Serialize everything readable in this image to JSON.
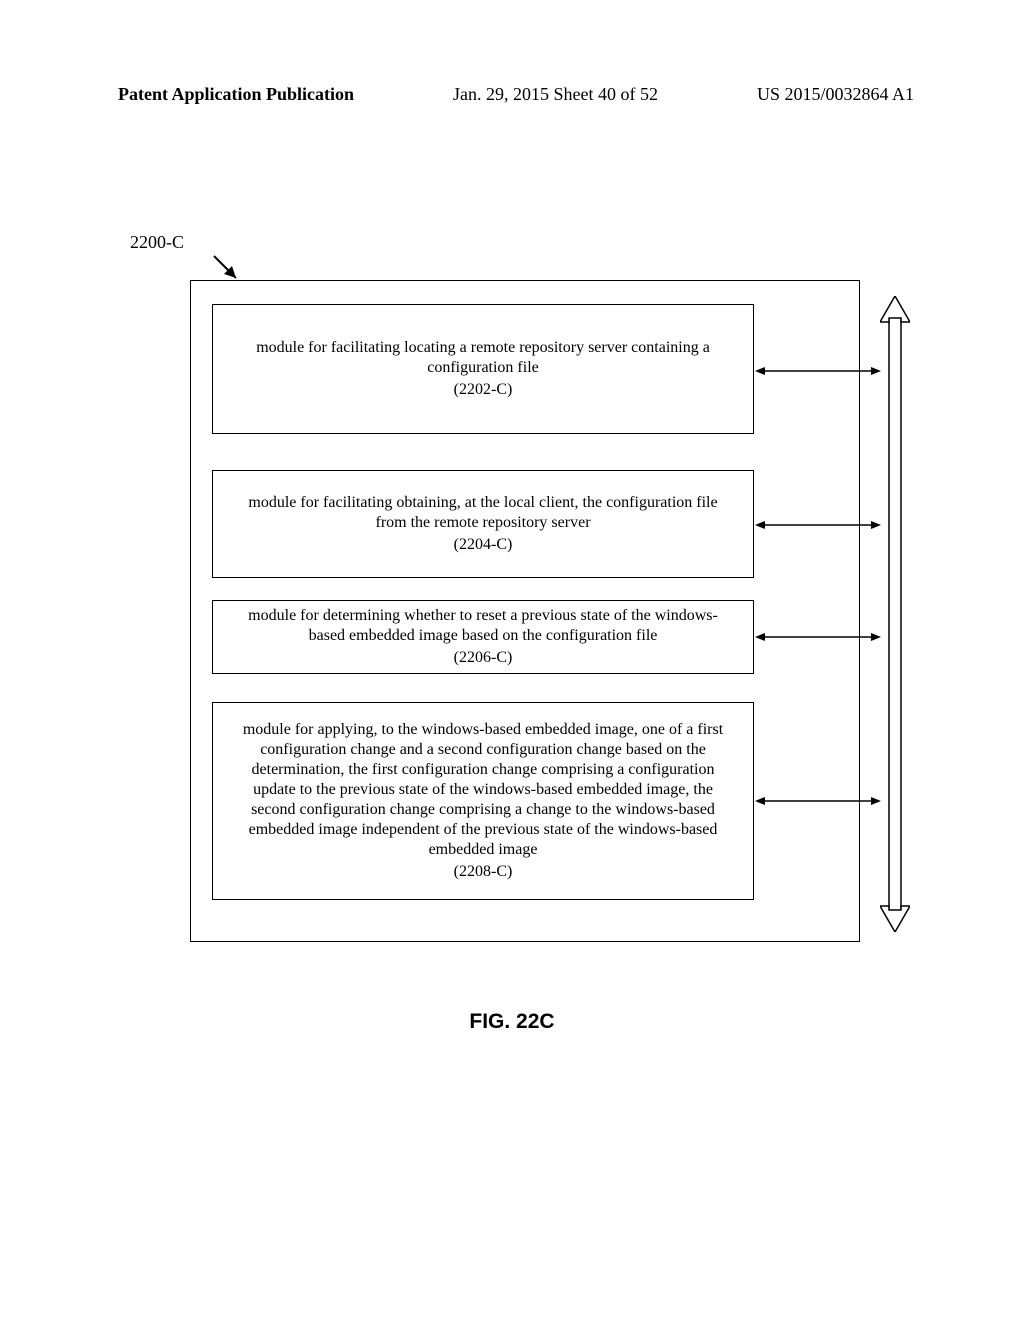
{
  "header": {
    "left": "Patent Application Publication",
    "center": "Jan. 29, 2015  Sheet 40 of 52",
    "right": "US 2015/0032864 A1"
  },
  "figure": {
    "system_label": "2200-C",
    "caption": "FIG. 22C",
    "modules": {
      "m1": {
        "text": "module for facilitating locating a remote repository server containing a configuration file",
        "ref": "(2202-C)"
      },
      "m2": {
        "text": "module for facilitating obtaining, at the local client, the configuration file from the remote repository server",
        "ref": "(2204-C)"
      },
      "m3": {
        "text": "module for determining whether to reset a previous state of the windows-based embedded image based on the configuration file",
        "ref": "(2206-C)"
      },
      "m4": {
        "text": "module for applying, to the windows-based embedded image, one of a first configuration change and a second configuration change based on the determination, the first configuration change comprising a configuration update to the previous state of the windows-based embedded image, the second configuration change comprising a change to the windows-based embedded image independent of the previous state of the windows-based embedded image",
        "ref": "(2208-C)"
      }
    }
  }
}
